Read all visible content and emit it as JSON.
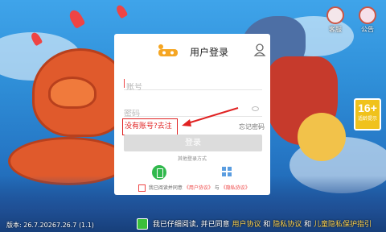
{
  "app": {
    "customer_service_label": "客服",
    "announcement_label": "公告",
    "age_rating_number": "16+",
    "age_rating_text": "适龄提示"
  },
  "login": {
    "title": "用户登录",
    "account_placeholder": "账号",
    "password_placeholder": "密码",
    "register_link": "没有账号?去注册",
    "forgot_password": "忘记密码",
    "login_button": "登录",
    "other_methods": "其他登录方式",
    "agree_prefix": "我已阅读并同意",
    "user_agreement": "《用户协议》",
    "and": "与",
    "privacy_policy": "《隐私协议》"
  },
  "footer": {
    "version": "版本: 26.7.20267.26.7 (1.1)",
    "agree_text_1": "我已仔细阅读, 并已同意",
    "user_agreement": "用户协议",
    "and_1": "和",
    "privacy_policy": "隐私协议",
    "and_2": "和",
    "child_privacy": "儿童隐私保护指引"
  },
  "colors": {
    "accent_red": "#e02222",
    "phone_green": "#31b94d",
    "footer_link": "#ffd34e"
  }
}
